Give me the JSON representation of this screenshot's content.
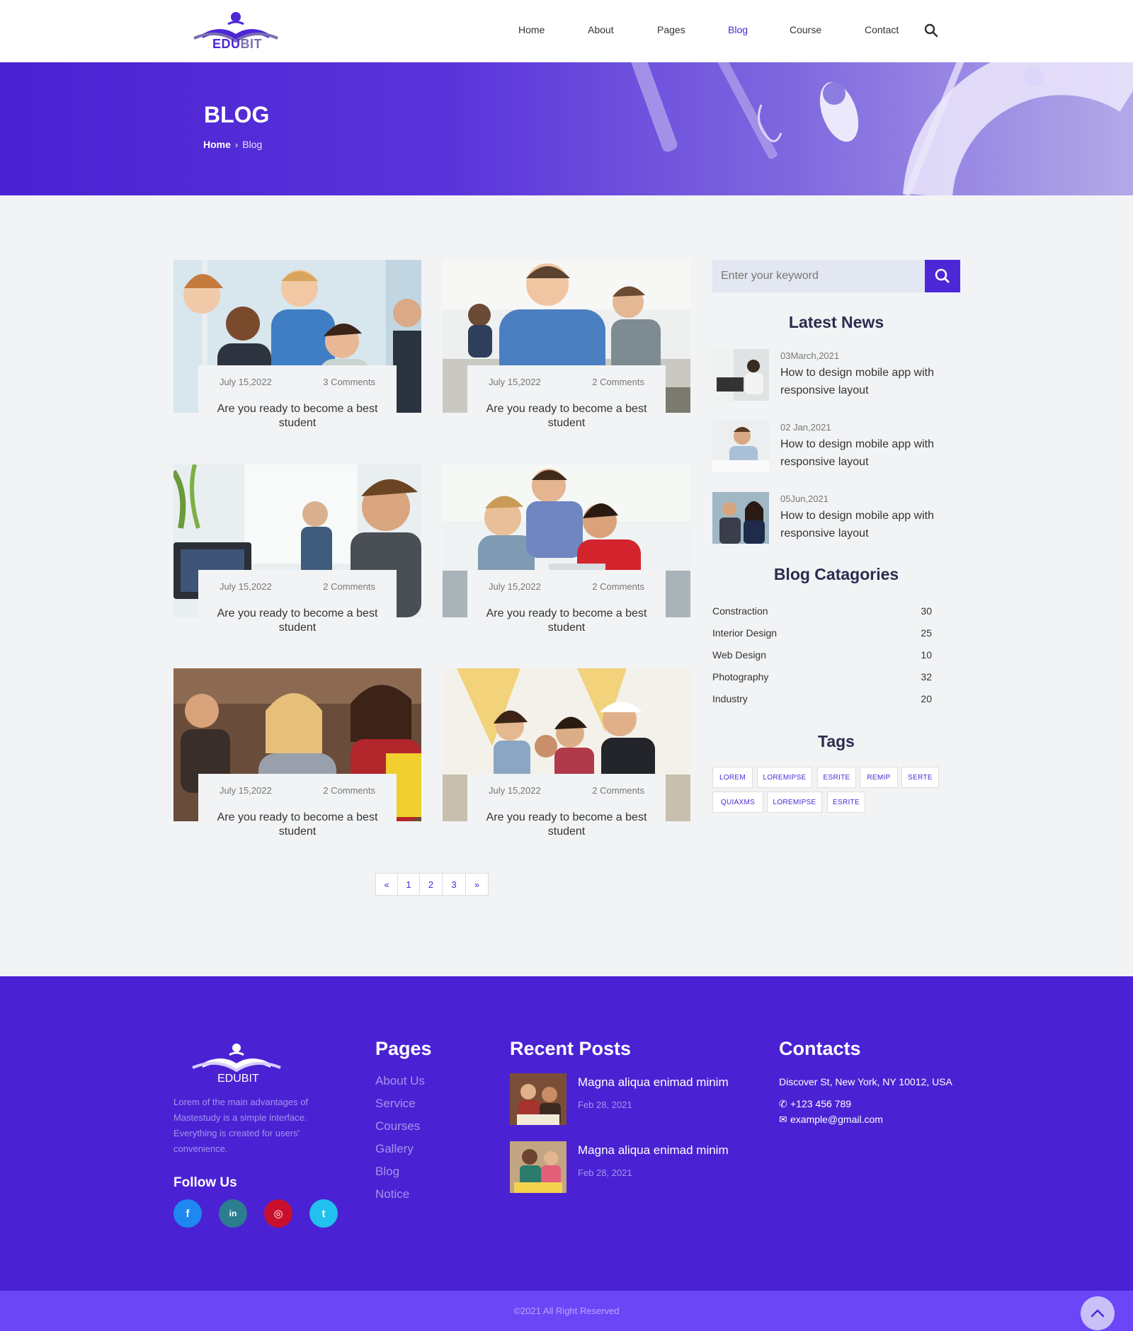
{
  "brand": {
    "name_a": "EDU",
    "name_b": "BIT",
    "accent": "#4d26d6"
  },
  "nav": {
    "items": [
      "Home",
      "About",
      "Pages",
      "Blog",
      "Course",
      "Contact"
    ],
    "active": "Blog"
  },
  "banner": {
    "title": "BLOG",
    "crumb_home": "Home",
    "crumb_current": "Blog"
  },
  "posts": [
    {
      "date": "July 15,2022",
      "comments": "3 Comments",
      "title": "Are you ready to become a best student"
    },
    {
      "date": "July 15,2022",
      "comments": "2 Comments",
      "title": "Are you ready to become a best student"
    },
    {
      "date": "July 15,2022",
      "comments": "2 Comments",
      "title": "Are you ready to become a best student"
    },
    {
      "date": "July 15,2022",
      "comments": "2 Comments",
      "title": "Are you ready to become a best student"
    },
    {
      "date": "July 15,2022",
      "comments": "2 Comments",
      "title": "Are you ready to become a best student"
    },
    {
      "date": "July 15,2022",
      "comments": "2 Comments",
      "title": "Are you ready to become a best student"
    }
  ],
  "pagination": [
    "«",
    "1",
    "2",
    "3",
    "»"
  ],
  "sidebar": {
    "search_placeholder": "Enter your keyword",
    "latest_title": "Latest News",
    "latest": [
      {
        "date": "03March,2021",
        "title": "How to design mobile app with responsive layout"
      },
      {
        "date": "02 Jan,2021",
        "title": "How to design mobile app with responsive layout"
      },
      {
        "date": "05Jun,2021",
        "title": "How to design mobile app with responsive layout"
      }
    ],
    "categories_title": "Blog Catagories",
    "categories": [
      {
        "name": "Constraction",
        "count": "30"
      },
      {
        "name": "Interior Design",
        "count": "25"
      },
      {
        "name": "Web Design",
        "count": "10"
      },
      {
        "name": "Photography",
        "count": "32"
      },
      {
        "name": "Industry",
        "count": "20"
      }
    ],
    "tags_title": "Tags",
    "tags": [
      "LOREM",
      "LOREMIPSE",
      "ESRITE",
      "REMIP",
      "SERTE",
      "QUIAXMS",
      "LOREMIPSE",
      "ESRITE"
    ]
  },
  "footer": {
    "brand": "EDUBIT",
    "about": "Lorem of the main advantages of Mastestudy is a simple interface. Everything is created for users' convenience.",
    "follow_title": "Follow Us",
    "social": [
      {
        "icon": "facebook-icon",
        "glyph": "f",
        "color": "#1e87f0"
      },
      {
        "icon": "linkedin-icon",
        "glyph": "in",
        "color": "#2b7d8f"
      },
      {
        "icon": "instagram-icon",
        "glyph": "◎",
        "color": "#c8102e"
      },
      {
        "icon": "twitter-icon",
        "glyph": "t",
        "color": "#22c0ee"
      }
    ],
    "pages_title": "Pages",
    "pages": [
      "About Us",
      "Service",
      "Courses",
      "Gallery",
      "Blog",
      "Notice"
    ],
    "recent_title": "Recent Posts",
    "recent": [
      {
        "title": "Magna aliqua enimad minim",
        "date": "Feb 28, 2021"
      },
      {
        "title": "Magna aliqua enimad minim",
        "date": "Feb 28, 2021"
      }
    ],
    "contacts_title": "Contacts",
    "address": "Discover St, New York, NY 10012, USA",
    "phone": "+123 456 789",
    "email": "example@gmail.com",
    "copyright": "©2021 All Right Reserved"
  }
}
